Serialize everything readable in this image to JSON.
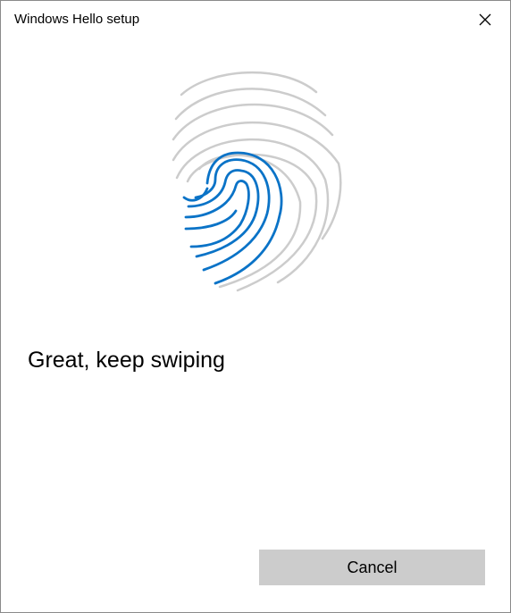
{
  "window": {
    "title": "Windows Hello setup",
    "close_icon": "close-icon"
  },
  "fingerprint": {
    "icon": "fingerprint-icon",
    "scan_color": "#0a73c7",
    "pending_color": "#cccccc"
  },
  "status": {
    "message": "Great, keep swiping"
  },
  "actions": {
    "cancel_label": "Cancel"
  }
}
